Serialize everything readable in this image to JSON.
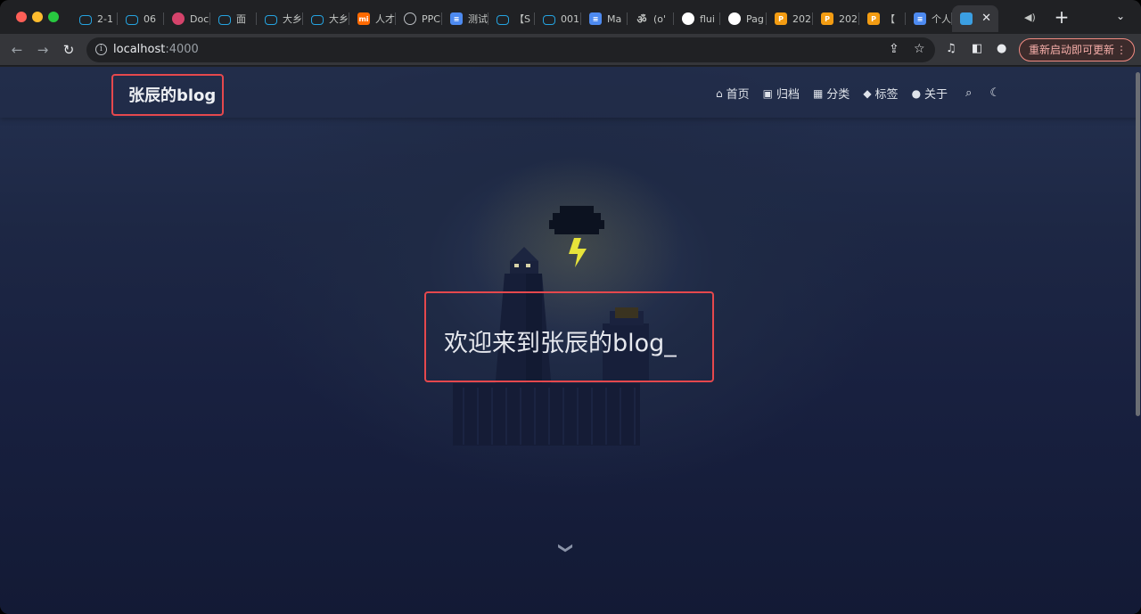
{
  "browser": {
    "tabs": [
      {
        "label": "2-1",
        "icon": "bilibili-icon"
      },
      {
        "label": "06",
        "icon": "bilibili-icon"
      },
      {
        "label": "Doc",
        "icon": "dingtalk-icon"
      },
      {
        "label": "面",
        "icon": "bilibili-icon"
      },
      {
        "label": "大乡",
        "icon": "bilibili-icon"
      },
      {
        "label": "大乡",
        "icon": "bilibili-icon"
      },
      {
        "label": "人才",
        "icon": "xiaomi-icon"
      },
      {
        "label": "PPC",
        "icon": "globe-icon"
      },
      {
        "label": "测试",
        "icon": "docs-icon"
      },
      {
        "label": "【S",
        "icon": "bilibili-icon"
      },
      {
        "label": "001",
        "icon": "bilibili-icon"
      },
      {
        "label": "Ma",
        "icon": "docs-icon"
      },
      {
        "label": "(o'",
        "icon": "om-icon"
      },
      {
        "label": "flui",
        "icon": "github-icon"
      },
      {
        "label": "Pag",
        "icon": "github-icon"
      },
      {
        "label": "202",
        "icon": "pp-icon"
      },
      {
        "label": "202",
        "icon": "pp-icon"
      },
      {
        "label": "【",
        "icon": "pp-icon"
      },
      {
        "label": "个人",
        "icon": "docs-icon"
      },
      {
        "label": "",
        "icon": "image-icon",
        "active": true
      }
    ],
    "close_glyph": "✕",
    "new_tab_glyph": "+",
    "url_host": "localhost",
    "url_port": ":4000",
    "update_button": "重新启动即可更新",
    "update_color": "#f28b82"
  },
  "site": {
    "brand": "张辰的blog",
    "nav": [
      {
        "label": "首页",
        "icon": "home-icon"
      },
      {
        "label": "归档",
        "icon": "archive-icon"
      },
      {
        "label": "分类",
        "icon": "grid-icon"
      },
      {
        "label": "标签",
        "icon": "tags-icon"
      },
      {
        "label": "关于",
        "icon": "user-icon"
      }
    ],
    "hero_title": "欢迎来到张辰的blog_",
    "highlight_color": "#e5484d"
  }
}
